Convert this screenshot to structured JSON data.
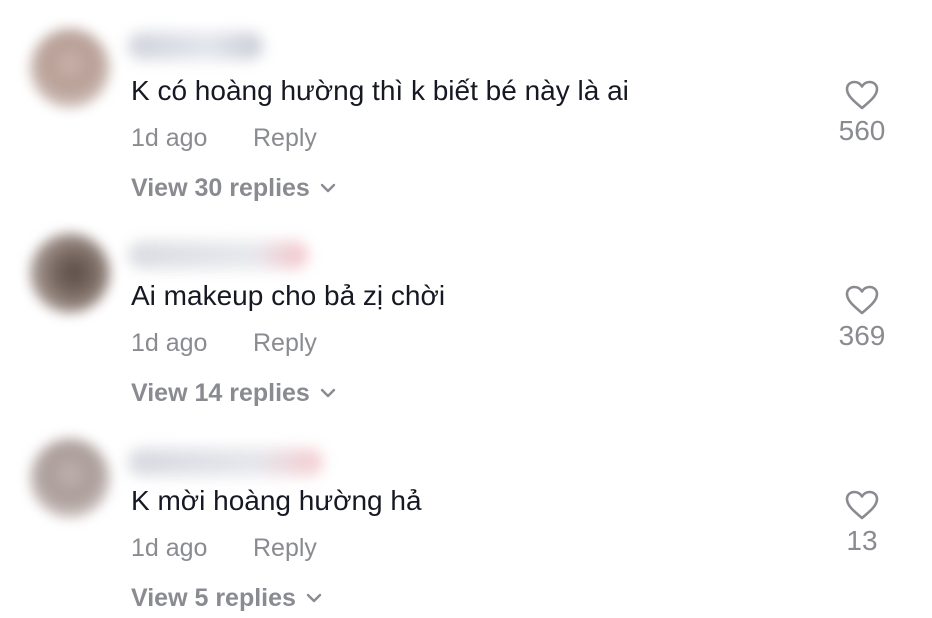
{
  "comments": [
    {
      "text": "K có hoàng hường thì k biết bé này là ai",
      "time": "1d ago",
      "reply_label": "Reply",
      "view_replies": "View 30 replies",
      "likes": "560"
    },
    {
      "text": "Ai makeup cho bả zị chời",
      "time": "1d ago",
      "reply_label": "Reply",
      "view_replies": "View 14 replies",
      "likes": "369"
    },
    {
      "text": "K mời hoàng hường hả",
      "time": "1d ago",
      "reply_label": "Reply",
      "view_replies": "View 5 replies",
      "likes": "13"
    }
  ],
  "colors": {
    "text": "#161823",
    "muted": "#8a8b91",
    "background": "#ffffff"
  },
  "icons": [
    "heart-outline-icon",
    "chevron-down-icon"
  ]
}
